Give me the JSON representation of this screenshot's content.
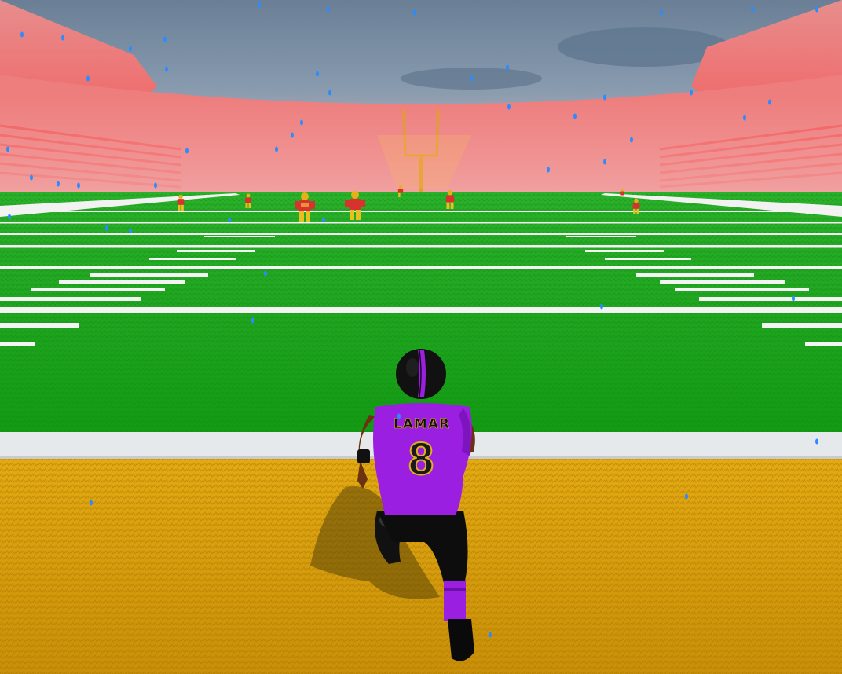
{
  "player": {
    "name": "LAMAR",
    "number": "8"
  },
  "colors": {
    "sky": "#6f87a0",
    "stands": "#e85a5a",
    "field_green": "#1fa61f",
    "endzone_gold": "#d9a20f",
    "jersey_purple": "#9b1fe0",
    "opponent_red": "#d8322e",
    "rain": "#2a8cff"
  },
  "icons": {
    "goalpost": "goalpost-icon",
    "rain": "raindrop-icon"
  }
}
